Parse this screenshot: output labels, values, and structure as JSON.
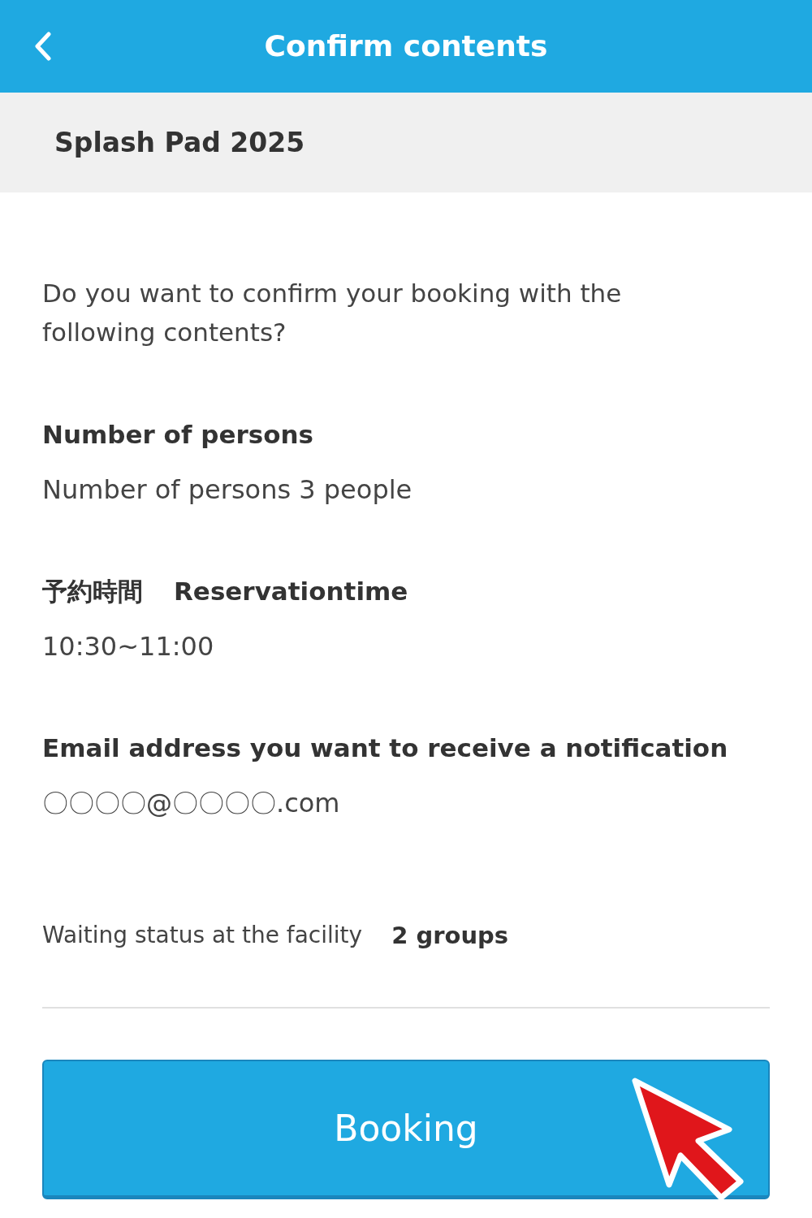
{
  "header": {
    "title": "Confirm contents"
  },
  "event": {
    "name": "Splash Pad 2025"
  },
  "prompt": "Do you want to confirm your booking with the following contents?",
  "sections": [
    {
      "headings": [
        "Number of persons"
      ],
      "value": "Number of persons 3 people"
    },
    {
      "headings": [
        "予約時間",
        "Reservationtime"
      ],
      "value": "10:30~11:00"
    },
    {
      "headings": [
        "Email address you want to receive a notification"
      ],
      "value": "〇〇〇〇@〇〇〇〇.com"
    }
  ],
  "waiting": {
    "label": "Waiting status at the facility",
    "value": "2 groups"
  },
  "button": {
    "label": "Booking"
  }
}
